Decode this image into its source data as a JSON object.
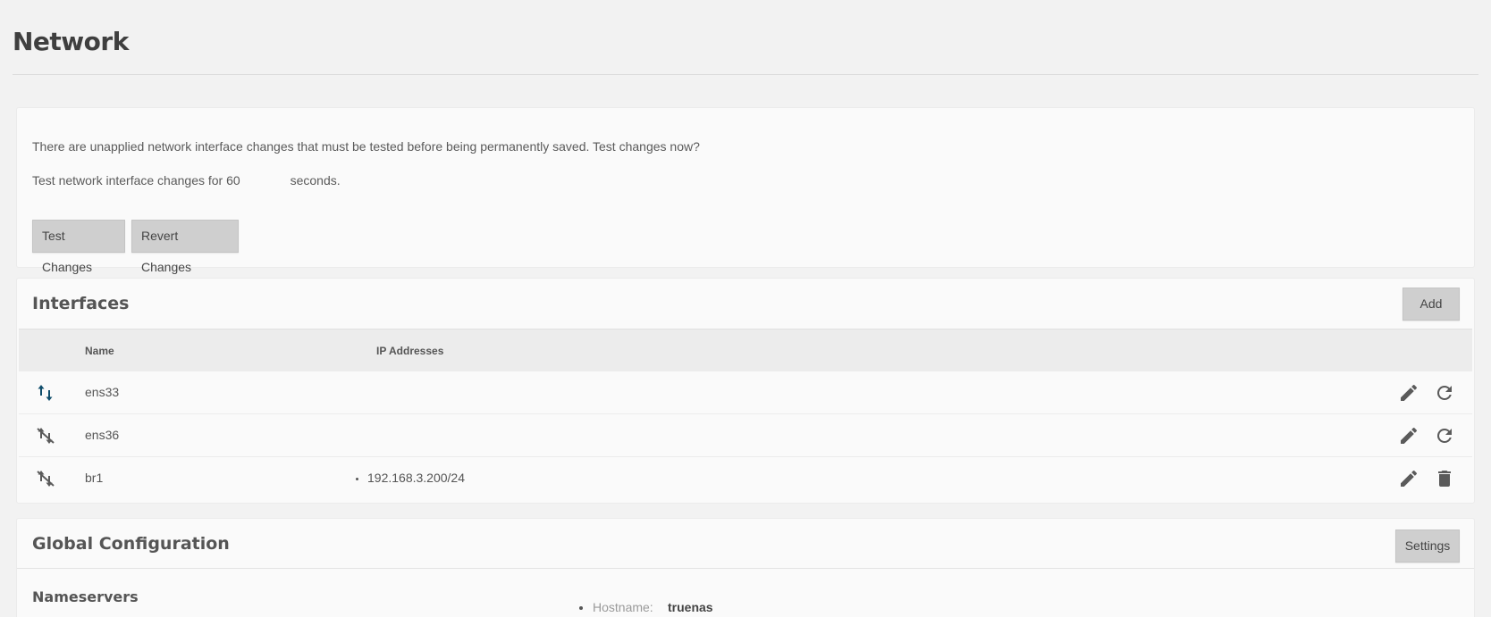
{
  "page": {
    "title": "Network"
  },
  "pending": {
    "message": "There are unapplied network interface changes that must be tested before being permanently saved. Test changes now?",
    "test_prefix": "Test network interface changes for",
    "test_seconds": "60",
    "test_suffix": "seconds.",
    "test_button": "Test Changes",
    "revert_button": "Revert Changes"
  },
  "interfaces": {
    "title": "Interfaces",
    "add_button": "Add",
    "columns": {
      "name": "Name",
      "ip": "IP Addresses"
    },
    "rows": [
      {
        "name": "ens33",
        "status_icon": "link-up-icon",
        "ip": "",
        "actions": [
          "edit-icon",
          "reset-icon"
        ]
      },
      {
        "name": "ens36",
        "status_icon": "link-down-icon",
        "ip": "",
        "actions": [
          "edit-icon",
          "reset-icon"
        ]
      },
      {
        "name": "br1",
        "status_icon": "link-down-icon",
        "ip": "192.168.3.200/24",
        "actions": [
          "edit-icon",
          "delete-icon"
        ]
      }
    ]
  },
  "global": {
    "title": "Global Configuration",
    "settings_button": "Settings",
    "nameservers_title": "Nameservers",
    "hostname_label": "Hostname:",
    "hostname_value": "truenas"
  },
  "colors": {
    "page_bg": "#f2f2f2",
    "card_bg": "#fafafa",
    "button_bg": "#cfcfcf",
    "link_up_icon": "#0f4d6b",
    "icon_gray": "#5a5a5a"
  }
}
